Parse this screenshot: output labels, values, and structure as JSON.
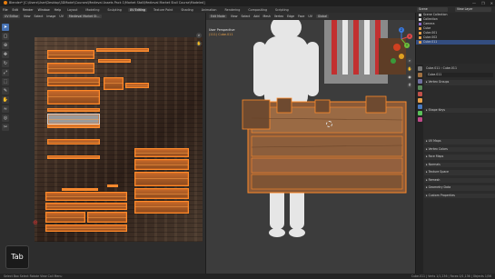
{
  "window": {
    "title": "Blender* [C:\\Users\\User\\Desktop\\3DModel\\Courses\\Medieval Assets Pack 1\\Market Stall\\Medieval Market Stall Course\\Modeled]",
    "controls": [
      "—",
      "❐",
      "✕"
    ]
  },
  "menubar": {
    "menus": [
      "File",
      "Edit",
      "Render",
      "Window",
      "Help"
    ],
    "workspaces": [
      "Layout",
      "Modeling",
      "Sculpting",
      "UV Editing",
      "Texture Paint",
      "Shading",
      "Animation",
      "Rendering",
      "Compositing",
      "Scripting"
    ],
    "active_workspace": "UV Editing",
    "scene": "Scene",
    "view_layer": "View Layer"
  },
  "uv_editor": {
    "header": [
      "UV Editor",
      "View",
      "Select",
      "Image",
      "UV"
    ],
    "image_name": "Medieval Market St...",
    "tab_key": "Tab",
    "tools": [
      "cursor-icon",
      "select-box-icon",
      "cursor3d-icon",
      "move-icon",
      "rotate-icon",
      "scale-icon",
      "transform-icon",
      "annotate-icon",
      "grab-icon",
      "relax-icon",
      "pinch-icon",
      "rip-icon"
    ]
  },
  "viewport": {
    "header": [
      "Edit Mode",
      "View",
      "Select",
      "Add",
      "Mesh",
      "Vertex",
      "Edge",
      "Face",
      "UV"
    ],
    "transform": "Global",
    "view_name": "User Perspective",
    "object_name": "(111) Cube.011",
    "gizmo_axes": [
      "X",
      "Y",
      "Z"
    ]
  },
  "outliner": {
    "items": [
      {
        "label": "Scene Collection",
        "color": "#bbbbbb"
      },
      {
        "label": "Collection",
        "color": "#e0e0e0"
      },
      {
        "label": "Camera",
        "color": "#8e6bd1"
      },
      {
        "label": "Cube",
        "color": "#e6a04a"
      },
      {
        "label": "Cube.001",
        "color": "#e6a04a"
      },
      {
        "label": "Cube.002",
        "color": "#e6a04a"
      },
      {
        "label": "Cube.011",
        "color": "#e6a04a",
        "selected": true
      }
    ]
  },
  "properties": {
    "object": "Cube.011",
    "mesh": "Cube.011",
    "name_field": "Cube.011",
    "sections_top": [
      "Vertex Groups",
      "Shape Keys"
    ],
    "sections_bottom": [
      "UV Maps",
      "Vertex Colors",
      "Face Maps",
      "Normals",
      "Texture Space",
      "Remesh",
      "Geometry Data",
      "Custom Properties"
    ]
  },
  "statusbar": {
    "left": "Select    Box Select    Rotate View    Call Menu",
    "right": "Cube.011 | Verts 1/1,236 | Faces 0/1,136 | Objects 1/56"
  },
  "colors": {
    "accent": "#4772b3",
    "uv_island": "#ff8a2a",
    "selection": "#334d80"
  }
}
